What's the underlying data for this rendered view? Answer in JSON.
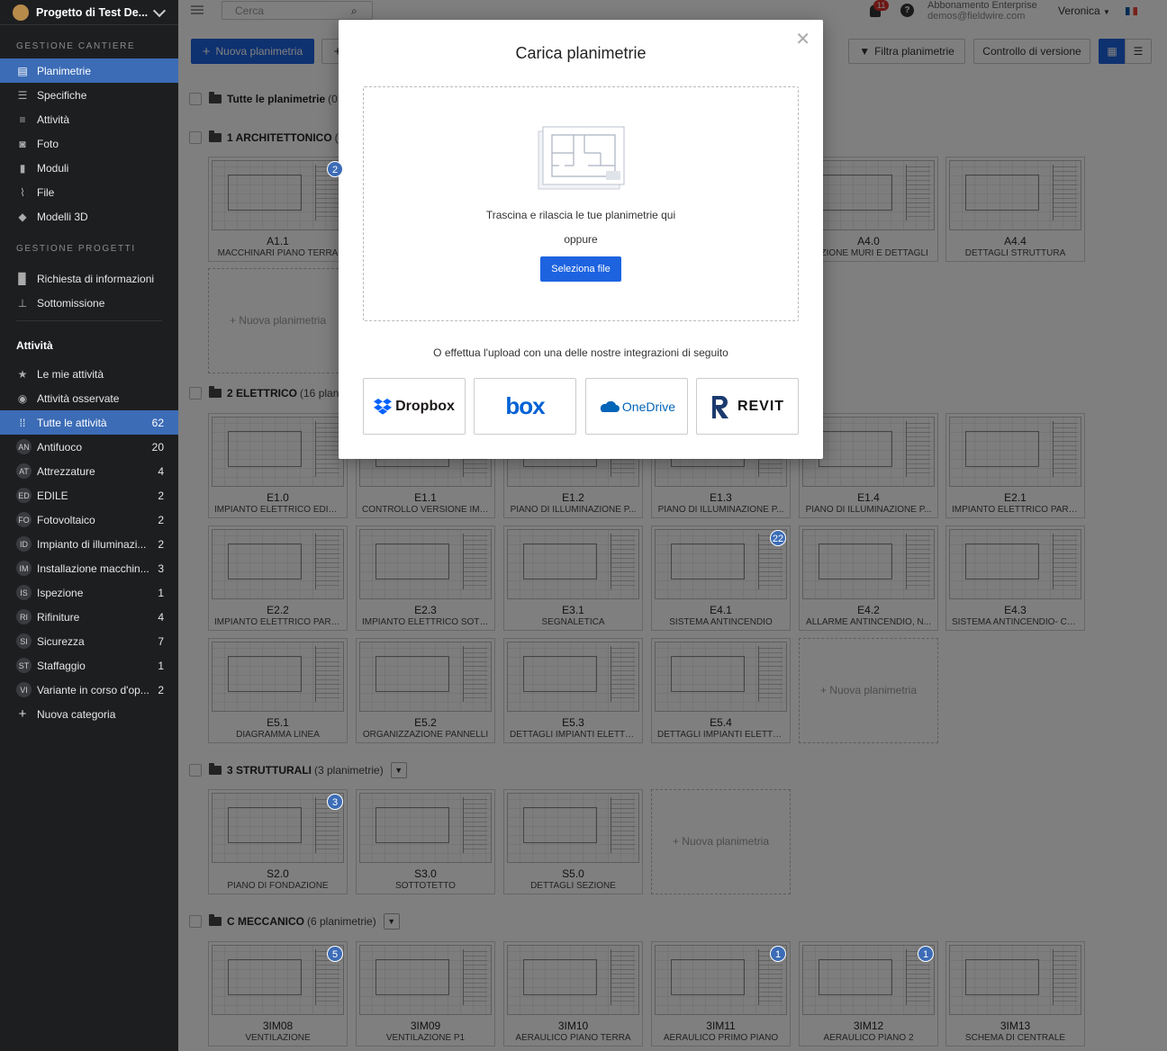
{
  "project": {
    "name": "Progetto di Test De..."
  },
  "sidebar": {
    "section1": "GESTIONE CANTIERE",
    "items1": [
      {
        "label": "Planimetrie",
        "icon": "floorplan-icon"
      },
      {
        "label": "Specifiche",
        "icon": "list-icon"
      },
      {
        "label": "Attività",
        "icon": "tasks-icon"
      },
      {
        "label": "Foto",
        "icon": "camera-icon"
      },
      {
        "label": "Moduli",
        "icon": "clipboard-icon"
      },
      {
        "label": "File",
        "icon": "paperclip-icon"
      },
      {
        "label": "Modelli 3D",
        "icon": "cube-icon"
      }
    ],
    "section2": "GESTIONE PROGETTI",
    "items2": [
      {
        "label": "Richiesta di informazioni",
        "icon": "document-icon"
      },
      {
        "label": "Sottomissione",
        "icon": "stamp-icon"
      }
    ],
    "section3": "Attività",
    "items3": [
      {
        "label": "Le mie attività",
        "icon": "star-icon"
      },
      {
        "label": "Attività osservate",
        "icon": "eye-icon"
      },
      {
        "label": "Tutte le attività",
        "icon": "grid-icon",
        "count": "62"
      }
    ],
    "categories": [
      {
        "abbr": "AN",
        "label": "Antifuoco",
        "count": "20"
      },
      {
        "abbr": "AT",
        "label": "Attrezzature",
        "count": "4"
      },
      {
        "abbr": "ED",
        "label": "EDILE",
        "count": "2"
      },
      {
        "abbr": "FO",
        "label": "Fotovoltaico",
        "count": "2"
      },
      {
        "abbr": "ID",
        "label": "Impianto di illuminazi...",
        "count": "2"
      },
      {
        "abbr": "IM",
        "label": "Installazione macchin...",
        "count": "3"
      },
      {
        "abbr": "IS",
        "label": "Ispezione",
        "count": "1"
      },
      {
        "abbr": "RI",
        "label": "Rifiniture",
        "count": "4"
      },
      {
        "abbr": "SI",
        "label": "Sicurezza",
        "count": "7"
      },
      {
        "abbr": "ST",
        "label": "Staffaggio",
        "count": "1"
      },
      {
        "abbr": "VI",
        "label": "Variante in corso d'op...",
        "count": "2"
      }
    ],
    "new_category": "Nuova categoria"
  },
  "header": {
    "search_placeholder": "Cerca",
    "notif_count": "11",
    "help": "?",
    "subscription": "Abbonamento Enterprise",
    "email": "demos@fieldwire.com",
    "user": "Veronica"
  },
  "toolbar": {
    "new_plan": "Nuova planimetria",
    "filter": "Filtra planimetrie",
    "version": "Controllo di versione"
  },
  "groups": {
    "all": {
      "name": "Tutte le planimetrie",
      "count": "(0 p"
    },
    "arch": {
      "name": "1 ARCHITETTONICO",
      "count": "(6"
    },
    "elet": {
      "name": "2 ELETTRICO",
      "count": "(16 planim"
    },
    "strut": {
      "name": "3 STRUTTURALI",
      "count": "(3 planimetrie)"
    },
    "mecc": {
      "name": "C MECCANICO",
      "count": "(6 planimetrie)"
    }
  },
  "new_plan_card": "+ Nuova planimetria",
  "plans": {
    "arch": [
      {
        "code": "A1.1",
        "name": "MACCHINARI PIANO TERRA",
        "badge": "2"
      },
      {
        "code": "A4.0",
        "name": "SEZIONE MURI E DETTAGLI"
      },
      {
        "code": "A4.4",
        "name": "DETTAGLI STRUTTURA"
      }
    ],
    "elet": [
      {
        "code": "E1.0",
        "name": "IMPIANTO ELETTRICO EDIFI..."
      },
      {
        "code": "E1.1",
        "name": "CONTROLLO VERSIONE IMP..."
      },
      {
        "code": "E1.2",
        "name": "PIANO DI ILLUMINAZIONE P..."
      },
      {
        "code": "E1.3",
        "name": "PIANO DI ILLUMINAZIONE P..."
      },
      {
        "code": "E1.4",
        "name": "PIANO DI ILLUMINAZIONE P..."
      },
      {
        "code": "E2.1",
        "name": "IMPIANTO ELETTRICO PARZ..."
      },
      {
        "code": "E2.2",
        "name": "IMPIANTO ELETTRICO PARZ..."
      },
      {
        "code": "E2.3",
        "name": "IMPIANTO ELETTRICO SOTT..."
      },
      {
        "code": "E3.1",
        "name": "SEGNALETICA"
      },
      {
        "code": "E4.1",
        "name": "SISTEMA ANTINCENDIO",
        "badge": "22"
      },
      {
        "code": "E4.2",
        "name": "ALLARME ANTINCENDIO, N..."
      },
      {
        "code": "E4.3",
        "name": "SISTEMA ANTINCENDIO- CAL..."
      },
      {
        "code": "E5.1",
        "name": "DIAGRAMMA LINEA"
      },
      {
        "code": "E5.2",
        "name": "ORGANIZZAZIONE PANNELLI"
      },
      {
        "code": "E5.3",
        "name": "DETTAGLI IMPIANTI ELETTR..."
      },
      {
        "code": "E5.4",
        "name": "DETTAGLI IMPIANTI ELETTR..."
      }
    ],
    "strut": [
      {
        "code": "S2.0",
        "name": "PIANO DI FONDAZIONE",
        "badge": "3"
      },
      {
        "code": "S3.0",
        "name": "SOTTOTETTO"
      },
      {
        "code": "S5.0",
        "name": "DETTAGLI SEZIONE"
      }
    ],
    "mecc": [
      {
        "code": "3IM08",
        "name": "VENTILAZIONE",
        "badge": "5"
      },
      {
        "code": "3IM09",
        "name": "VENTILAZIONE P1"
      },
      {
        "code": "3IM10",
        "name": "AERAULICO PIANO TERRA"
      },
      {
        "code": "3IM11",
        "name": "AERAULICO PRIMO PIANO",
        "badge": "1"
      },
      {
        "code": "3IM12",
        "name": "AERAULICO PIANO 2",
        "badge": "1"
      },
      {
        "code": "3IM13",
        "name": "SCHEMA DI CENTRALE"
      }
    ]
  },
  "modal": {
    "title": "Carica planimetrie",
    "drop_text": "Trascina e rilascia le tue planimetrie qui",
    "or": "oppure",
    "select_button": "Seleziona file",
    "integrations_text": "O effettua l'upload con una delle nostre integrazioni di seguito",
    "integrations": {
      "dropbox": "Dropbox",
      "box": "box",
      "onedrive": "OneDrive",
      "revit": "REVIT"
    },
    "colors": {
      "dropbox": "#0061fe",
      "box": "#0061d5",
      "onedrive": "#0364b8",
      "revit": "#111111"
    }
  }
}
